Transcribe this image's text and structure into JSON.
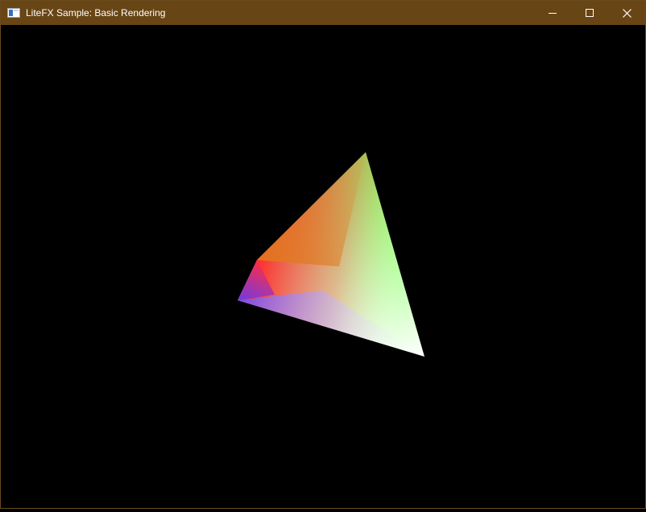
{
  "window": {
    "title": "LiteFX Sample: Basic Rendering",
    "title_bar_color": "#684514",
    "controls": {
      "minimize_icon": "minimize-icon",
      "maximize_icon": "maximize-icon",
      "close_icon": "close-icon"
    }
  },
  "viewport": {
    "background_color": "#000000",
    "scene": {
      "object": "tetrahedron",
      "vertex_colors": {
        "top": "#55ff22",
        "left": "#ff2a2a",
        "bottom_left": "#5a3cff",
        "bottom_right": "#ffffff"
      }
    }
  }
}
